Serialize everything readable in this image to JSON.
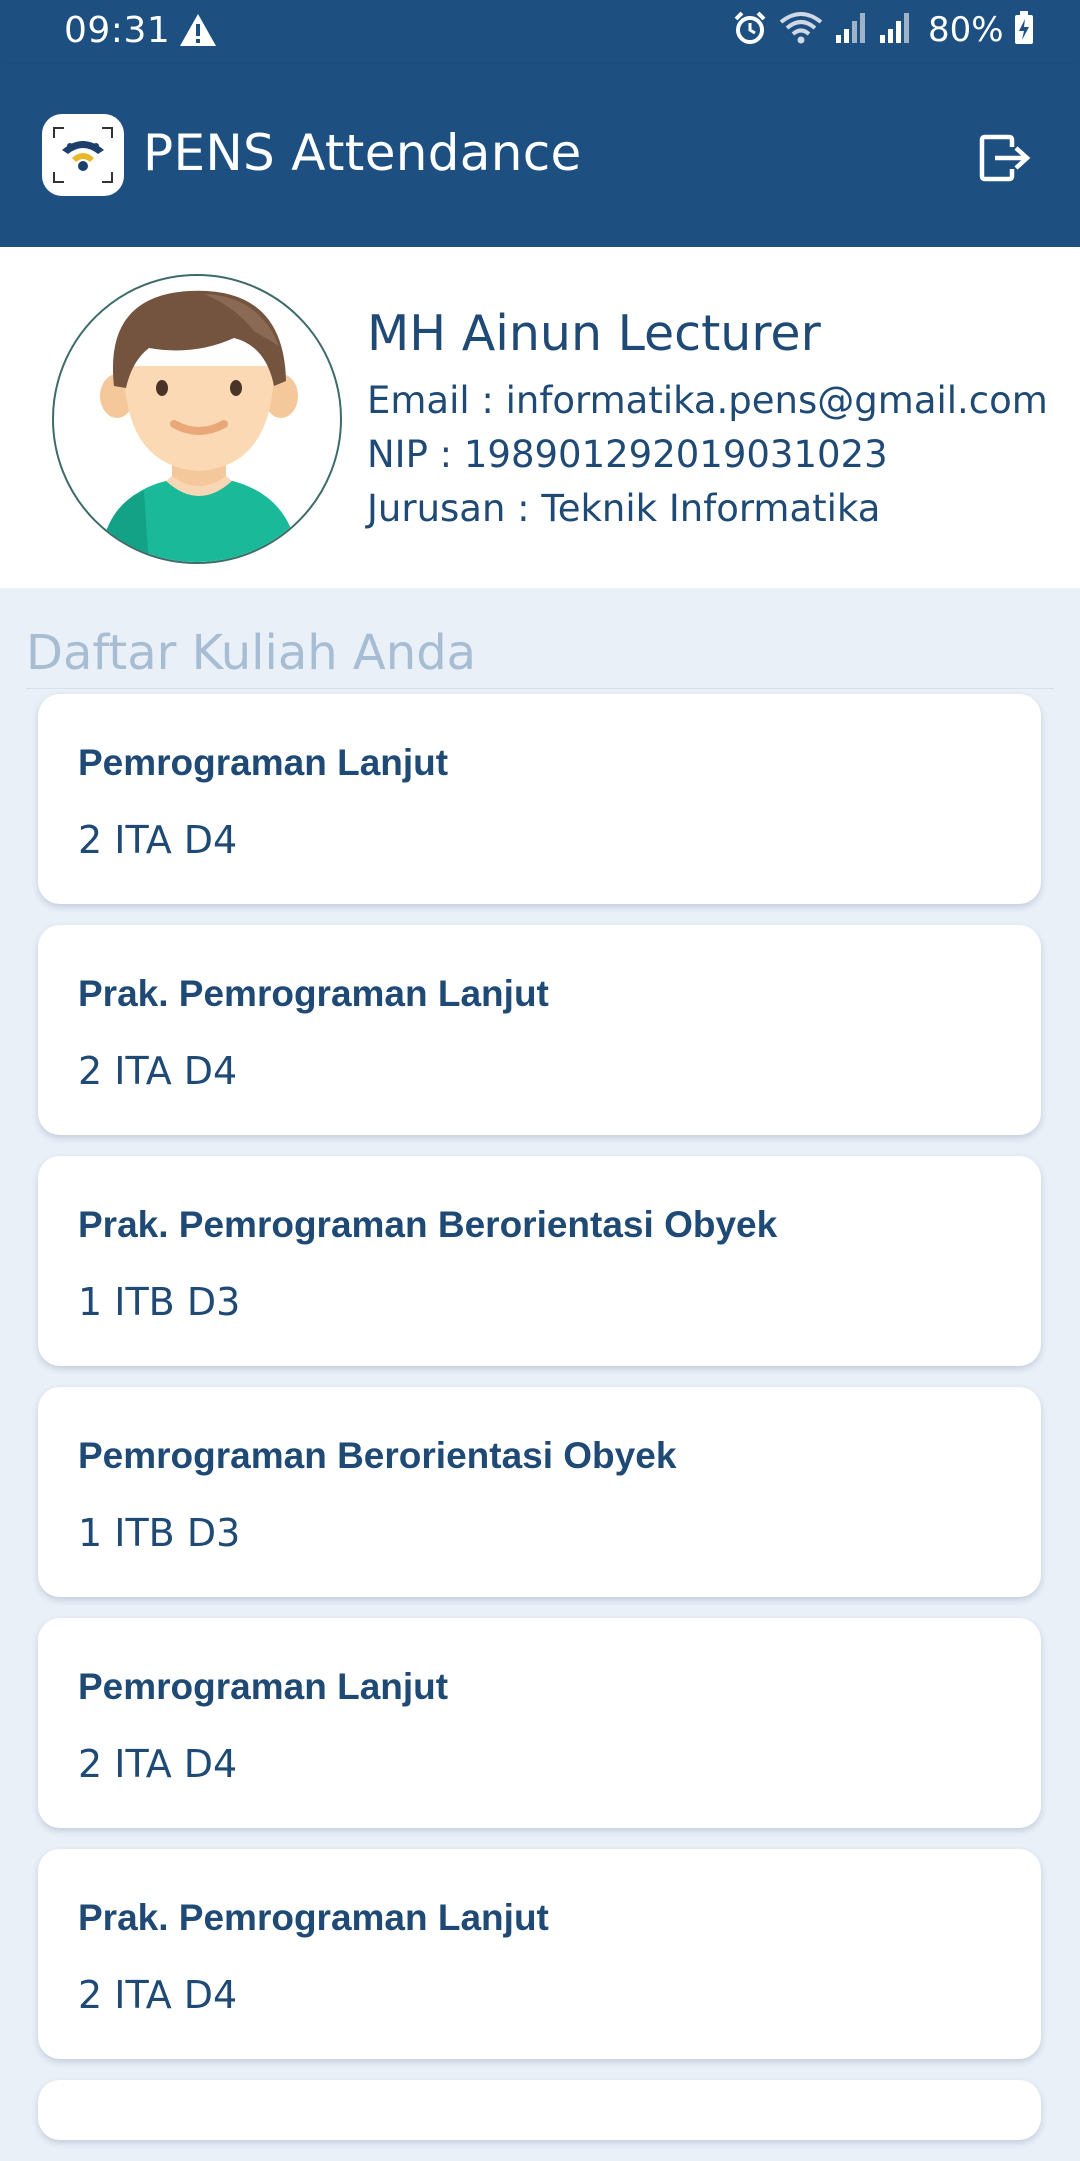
{
  "status_bar": {
    "time": "09:31",
    "battery": "80%",
    "icons": [
      "warning-icon",
      "alarm-icon",
      "wifi-icon",
      "signal-icon",
      "signal-icon",
      "battery-charging-icon"
    ]
  },
  "app_bar": {
    "title": "PENS Attendance",
    "logo_icon": "app-logo-icon",
    "action_icon": "logout-icon"
  },
  "profile": {
    "name": "MH Ainun Lecturer",
    "email": "Email : informatika.pens@gmail.com",
    "nip": "NIP : 198901292019031023",
    "jurusan": "Jurusan : Teknik Informatika"
  },
  "section": {
    "title": "Daftar Kuliah Anda"
  },
  "courses": [
    {
      "name": "Pemrograman Lanjut",
      "class": "2 ITA D4"
    },
    {
      "name": "Prak. Pemrograman Lanjut",
      "class": "2 ITA D4"
    },
    {
      "name": "Prak. Pemrograman Berorientasi Obyek",
      "class": "1 ITB D3"
    },
    {
      "name": "Pemrograman Berorientasi Obyek",
      "class": "1 ITB D3"
    },
    {
      "name": "Pemrograman Lanjut",
      "class": "2 ITA D4"
    },
    {
      "name": "Prak. Pemrograman Lanjut",
      "class": "2 ITA D4"
    }
  ],
  "colors": {
    "primary": "#1d4f80",
    "text": "#1f4a75",
    "background": "#eaf0f8",
    "section_title": "#a7bdd3",
    "card": "#ffffff"
  }
}
